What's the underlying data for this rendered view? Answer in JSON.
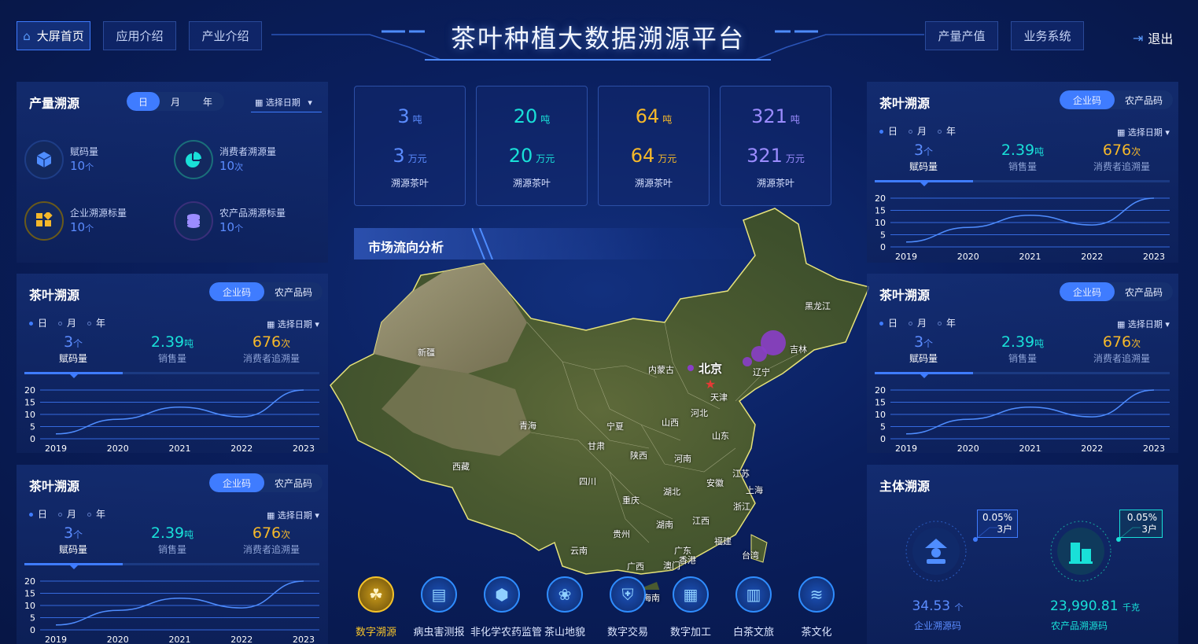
{
  "header": {
    "title": "茶叶种植大数据溯源平台",
    "nav_left": [
      "大屏首页",
      "应用介绍",
      "产业介绍"
    ],
    "nav_right": [
      "产量产值",
      "业务系统"
    ],
    "logout": "退出"
  },
  "yield": {
    "title": "产量溯源",
    "periods": [
      "日",
      "月",
      "年"
    ],
    "date": "选择日期",
    "items": [
      {
        "label": "赋码量",
        "value": "10",
        "unit": "个"
      },
      {
        "label": "消费者溯源量",
        "value": "10",
        "unit": "次"
      },
      {
        "label": "企业溯源标量",
        "value": "10",
        "unit": "个"
      },
      {
        "label": "农产品溯源标量",
        "value": "10",
        "unit": "个"
      }
    ]
  },
  "cards": [
    {
      "t": "3",
      "tu": "吨",
      "m": "3",
      "mu": "万元",
      "label": "溯源茶叶"
    },
    {
      "t": "20",
      "tu": "吨",
      "m": "20",
      "mu": "万元",
      "label": "溯源茶叶"
    },
    {
      "t": "64",
      "tu": "吨",
      "m": "64",
      "mu": "万元",
      "label": "溯源茶叶"
    },
    {
      "t": "321",
      "tu": "吨",
      "m": "321",
      "mu": "万元",
      "label": "溯源茶叶"
    }
  ],
  "trace": {
    "title": "茶叶溯源",
    "tabs": [
      "企业码",
      "农产品码"
    ],
    "periods": [
      "日",
      "月",
      "年"
    ],
    "date": "选择日期",
    "stats": [
      {
        "value": "3",
        "unit": "个",
        "label": "赋码量"
      },
      {
        "value": "2.39",
        "unit": "吨",
        "label": "销售量"
      },
      {
        "value": "676",
        "unit": "次",
        "label": "消费者追溯量"
      }
    ]
  },
  "chart_data": {
    "type": "line",
    "x": [
      "2019",
      "2020",
      "2021",
      "2022",
      "2023"
    ],
    "y": [
      2,
      8,
      13,
      9,
      20
    ],
    "ylim": [
      0,
      20
    ],
    "yticks": [
      "20",
      "15",
      "10",
      "5",
      "0"
    ]
  },
  "market": {
    "title": "市场流向分析"
  },
  "map_labels": [
    "新疆",
    "西藏",
    "青海",
    "内蒙古",
    "北京",
    "天津",
    "河北",
    "辽宁",
    "吉林",
    "黑龙江",
    "宁夏",
    "甘肃",
    "陕西",
    "山西",
    "山东",
    "河南",
    "四川",
    "重庆",
    "湖北",
    "安徽",
    "江苏",
    "上海",
    "浙江",
    "湖南",
    "江西",
    "贵州",
    "云南",
    "广西",
    "广东",
    "福建",
    "台湾",
    "香港",
    "澳门",
    "海南"
  ],
  "bottom_icons": [
    "数字溯源",
    "病虫害测报",
    "非化学农药监管",
    "茶山地貌",
    "数字交易",
    "数字加工",
    "白茶文旅",
    "茶文化"
  ],
  "subject": {
    "title": "主体溯源",
    "left": {
      "pct": "0.05%",
      "cnt": "3户",
      "value": "34.53",
      "unit": "个",
      "label": "企业溯源码"
    },
    "right": {
      "pct": "0.05%",
      "cnt": "3户",
      "value": "23,990.81",
      "unit": "千克",
      "label": "农产品溯源码"
    }
  },
  "colors": {
    "accent": "#3f7cff",
    "cyan": "#19e0d8",
    "gold": "#f5b82a",
    "purple": "#9b8cff"
  }
}
